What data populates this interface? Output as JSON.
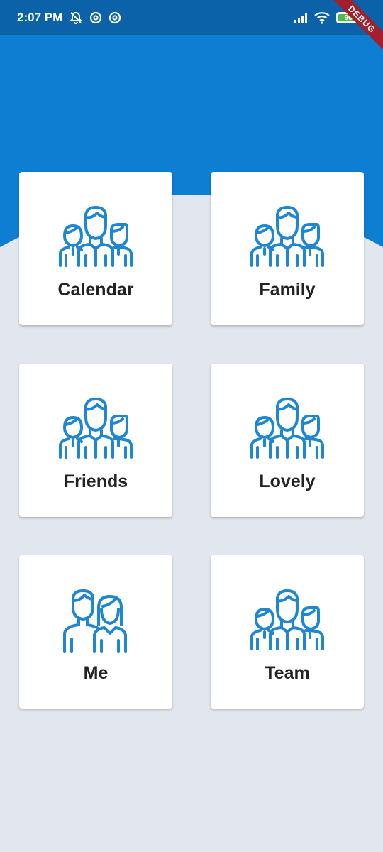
{
  "status_bar": {
    "time": "2:07 PM",
    "battery_level": "96",
    "battery_fill_fraction": 0.96,
    "icons": [
      "notifications-off-icon",
      "at-sign-icon",
      "at-sign-icon",
      "signal-icon",
      "wifi-icon",
      "battery-icon"
    ]
  },
  "debug_banner": {
    "label": "DEBUG"
  },
  "colors": {
    "primary": "#0d7ed2",
    "status_bar": "#0b62a8",
    "background": "#e2e7ef",
    "card": "#ffffff",
    "icon": "#1f87d2",
    "label": "#222222"
  },
  "menu": {
    "items": [
      {
        "label": "Calendar",
        "icon": "group-icon"
      },
      {
        "label": "Family",
        "icon": "group-icon"
      },
      {
        "label": "Friends",
        "icon": "group-icon"
      },
      {
        "label": "Lovely",
        "icon": "group-icon"
      },
      {
        "label": "Me",
        "icon": "couple-icon"
      },
      {
        "label": "Team",
        "icon": "group-icon"
      }
    ]
  }
}
